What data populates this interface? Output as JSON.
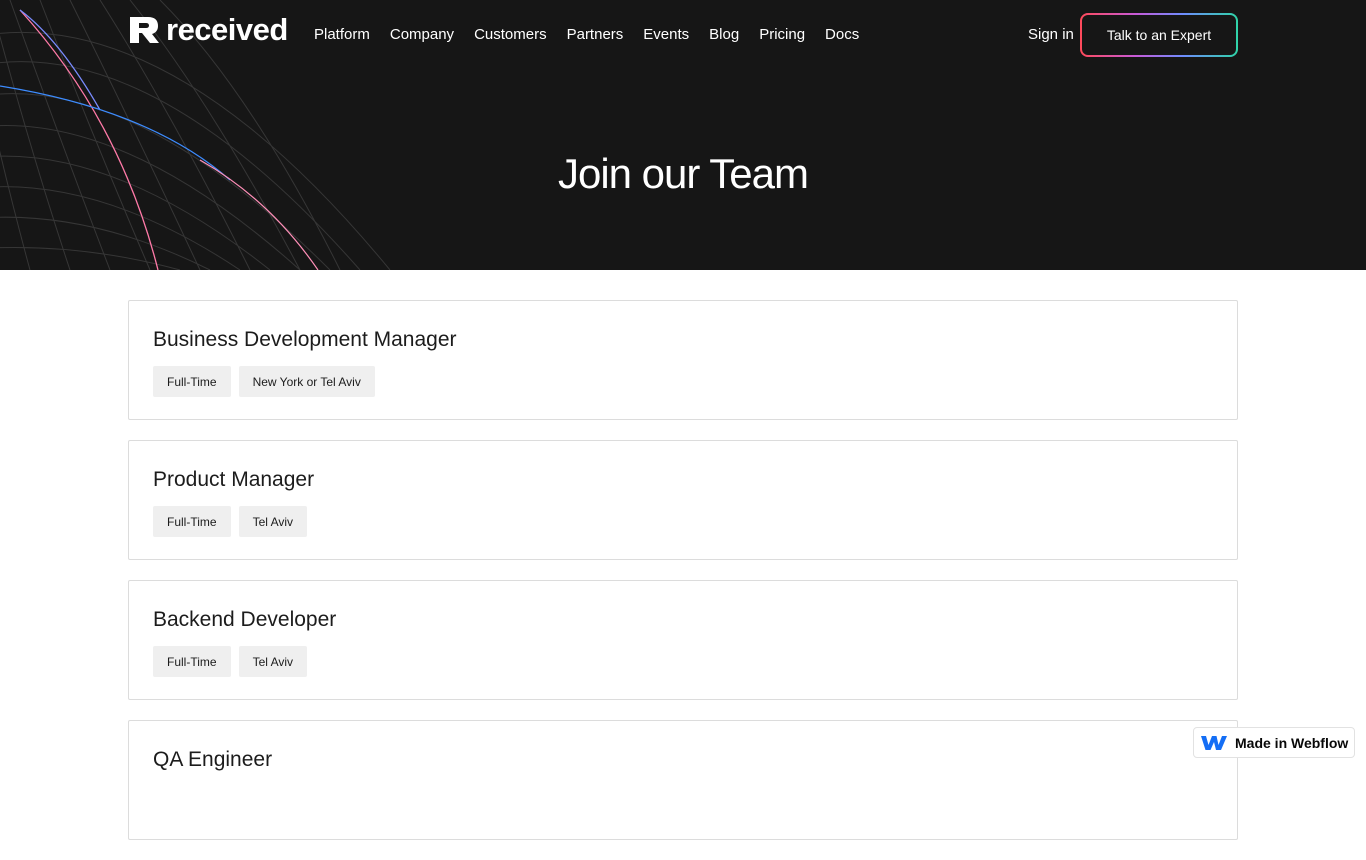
{
  "nav": {
    "logo_text": "received",
    "links": [
      "Platform",
      "Company",
      "Customers",
      "Partners",
      "Events",
      "Blog",
      "Pricing",
      "Docs"
    ],
    "sign_in": "Sign in",
    "cta": "Talk to an Expert"
  },
  "hero": {
    "title": "Join our Team"
  },
  "jobs": [
    {
      "title": "Business Development Manager",
      "tags": [
        "Full-Time",
        "New York or Tel Aviv"
      ]
    },
    {
      "title": "Product Manager",
      "tags": [
        "Full-Time",
        "Tel Aviv"
      ]
    },
    {
      "title": "Backend Developer",
      "tags": [
        "Full-Time",
        "Tel Aviv"
      ]
    },
    {
      "title": "QA Engineer",
      "tags": []
    }
  ],
  "badge": {
    "text": "Made in Webflow",
    "icon": "webflow-icon"
  },
  "colors": {
    "hero_bg": "#161616",
    "tag_bg": "#efefef",
    "card_border": "#dcdcdc",
    "badge_icon": "#146ef5"
  }
}
